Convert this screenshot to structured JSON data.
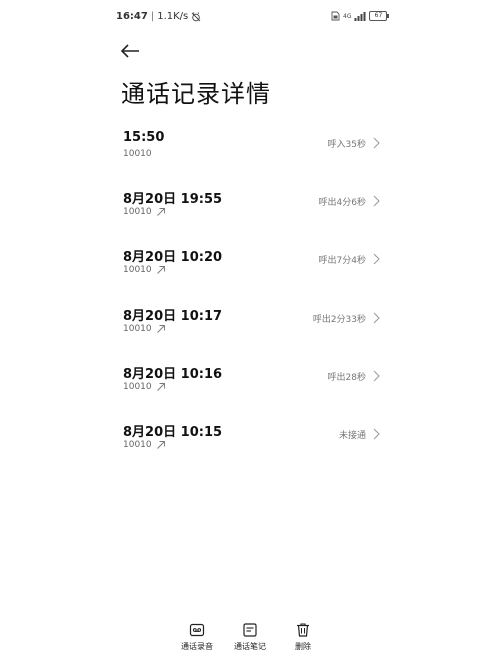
{
  "status_bar": {
    "time": "16:47",
    "network_speed": "1.1K/s",
    "battery": "67",
    "signal_label": "4G"
  },
  "header": {
    "title": "通话记录详情"
  },
  "calls": [
    {
      "when": "15:50",
      "number": "10010",
      "status": "呼入35秒",
      "outgoing": false
    },
    {
      "when": "8月20日 19:55",
      "number": "10010",
      "status": "呼出4分6秒",
      "outgoing": true
    },
    {
      "when": "8月20日 10:20",
      "number": "10010",
      "status": "呼出7分4秒",
      "outgoing": true
    },
    {
      "when": "8月20日 10:17",
      "number": "10010",
      "status": "呼出2分33秒",
      "outgoing": true
    },
    {
      "when": "8月20日 10:16",
      "number": "10010",
      "status": "呼出28秒",
      "outgoing": true
    },
    {
      "when": "8月20日 10:15",
      "number": "10010",
      "status": "未接通",
      "outgoing": true
    }
  ],
  "toolbar": {
    "recording_label": "通话录音",
    "notes_label": "通话笔记",
    "delete_label": "删除"
  }
}
